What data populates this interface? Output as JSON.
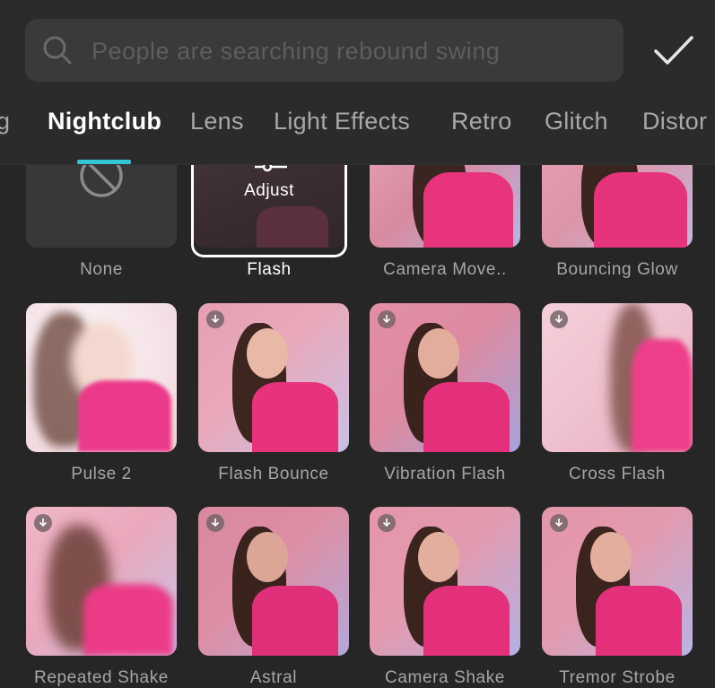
{
  "search": {
    "placeholder": "People are searching rebound swing",
    "icon": "search-icon"
  },
  "confirm_icon": "checkmark-icon",
  "tabs": [
    {
      "label": "g",
      "active": false
    },
    {
      "label": "Nightclub",
      "active": true
    },
    {
      "label": "Lens",
      "active": false
    },
    {
      "label": "Light Effects",
      "active": false
    },
    {
      "label": "Retro",
      "active": false
    },
    {
      "label": "Glitch",
      "active": false
    },
    {
      "label": "Distor",
      "active": false
    }
  ],
  "effects": [
    {
      "label": "None"
    },
    {
      "label": "Flash",
      "selected": true,
      "overlay": "Adjust"
    },
    {
      "label": "Camera Move.."
    },
    {
      "label": "Bouncing Glow"
    },
    {
      "label": "Pulse 2"
    },
    {
      "label": "Flash Bounce",
      "download": true
    },
    {
      "label": "Vibration Flash",
      "download": true
    },
    {
      "label": "Cross Flash",
      "download": true
    },
    {
      "label": "Repeated Shake",
      "download": true
    },
    {
      "label": "Astral",
      "download": true
    },
    {
      "label": "Camera Shake",
      "download": true
    },
    {
      "label": "Tremor Strobe",
      "download": true
    }
  ],
  "colors": {
    "accent": "#35c6d3",
    "background": "#262626",
    "search_bg": "#3a3a3a",
    "label": "#a6a6a6",
    "label_selected": "#ffffff"
  }
}
